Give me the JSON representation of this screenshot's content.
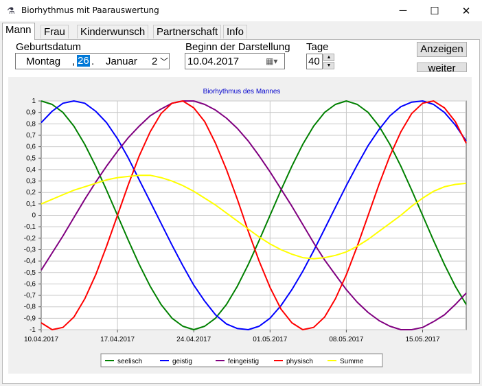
{
  "window": {
    "title": "Biorhythmus mit Paarauswertung",
    "minimize": "─",
    "maximize": "☐",
    "close": "✕",
    "icon": "flask-icon"
  },
  "tabs": [
    {
      "label": "Mann",
      "active": true
    },
    {
      "label": "Frau"
    },
    {
      "label": "Kinderwunsch"
    },
    {
      "label": "Partnerschaft"
    },
    {
      "label": "Info"
    }
  ],
  "form": {
    "birth_label": "Geburtsdatum",
    "birth_weekday": "Montag",
    "birth_sep": ",",
    "birth_day": "26",
    "birth_dot": ".",
    "birth_month": "Januar",
    "birth_year_partial": "2",
    "start_label": "Beginn der Darstellung",
    "start_date": "10.04.2017",
    "days_label": "Tage",
    "days_value": "40",
    "show_button": "Anzeigen",
    "next_button": "weiter"
  },
  "colors": {
    "seelisch": "#008000",
    "geistig": "#0000ff",
    "feingeistig": "#800080",
    "physisch": "#ff0000",
    "summe": "#ffff00",
    "title": "#0000cc"
  },
  "chart_data": {
    "type": "line",
    "title": "Biorhythmus des Mannes",
    "x_start": "10.04.2017",
    "x_end": "19.05.2017",
    "x_tick_labels": [
      "10.04.2017",
      "17.04.2017",
      "24.04.2017",
      "01.05.2017",
      "08.05.2017",
      "15.05.2017"
    ],
    "ylim": [
      -1,
      1
    ],
    "y_tick_labels": [
      "1",
      "0,9",
      "0,8",
      "0,7",
      "0,6",
      "0,5",
      "0,4",
      "0,3",
      "0,2",
      "0,1",
      "0",
      "-0,1",
      "-0,2",
      "-0,3",
      "-0,4",
      "-0,5",
      "-0,6",
      "-0,7",
      "-0,8",
      "-0,9",
      "-1"
    ],
    "grid": true,
    "legend_position": "bottom",
    "dates": [
      "10.04.2017",
      "11.04.2017",
      "12.04.2017",
      "13.04.2017",
      "14.04.2017",
      "15.04.2017",
      "16.04.2017",
      "17.04.2017",
      "18.04.2017",
      "19.04.2017",
      "20.04.2017",
      "21.04.2017",
      "22.04.2017",
      "23.04.2017",
      "24.04.2017",
      "25.04.2017",
      "26.04.2017",
      "27.04.2017",
      "28.04.2017",
      "29.04.2017",
      "30.04.2017",
      "01.05.2017",
      "02.05.2017",
      "03.05.2017",
      "04.05.2017",
      "05.05.2017",
      "06.05.2017",
      "07.05.2017",
      "08.05.2017",
      "09.05.2017",
      "10.05.2017",
      "11.05.2017",
      "12.05.2017",
      "13.05.2017",
      "14.05.2017",
      "15.05.2017",
      "16.05.2017",
      "17.05.2017",
      "18.05.2017",
      "19.05.2017"
    ],
    "series": [
      {
        "name": "seelisch",
        "values": [
          1.0,
          0.97,
          0.9,
          0.78,
          0.62,
          0.43,
          0.22,
          0.0,
          -0.22,
          -0.43,
          -0.62,
          -0.78,
          -0.9,
          -0.97,
          -1.0,
          -0.97,
          -0.9,
          -0.78,
          -0.62,
          -0.43,
          -0.22,
          0.0,
          0.22,
          0.43,
          0.62,
          0.78,
          0.9,
          0.97,
          1.0,
          0.97,
          0.9,
          0.78,
          0.62,
          0.43,
          0.22,
          0.0,
          -0.22,
          -0.43,
          -0.62,
          -0.78
        ]
      },
      {
        "name": "geistig",
        "values": [
          0.81,
          0.91,
          0.98,
          1.0,
          0.98,
          0.91,
          0.81,
          0.67,
          0.5,
          0.31,
          0.12,
          -0.07,
          -0.26,
          -0.44,
          -0.61,
          -0.75,
          -0.87,
          -0.95,
          -0.99,
          -1.0,
          -0.97,
          -0.9,
          -0.79,
          -0.65,
          -0.49,
          -0.31,
          -0.12,
          0.07,
          0.26,
          0.44,
          0.61,
          0.75,
          0.87,
          0.95,
          0.99,
          1.0,
          0.97,
          0.9,
          0.79,
          0.65
        ]
      },
      {
        "name": "feingeistig",
        "values": [
          -0.48,
          -0.33,
          -0.18,
          -0.02,
          0.14,
          0.29,
          0.43,
          0.56,
          0.68,
          0.78,
          0.87,
          0.93,
          0.98,
          1.0,
          1.0,
          0.97,
          0.92,
          0.85,
          0.76,
          0.65,
          0.52,
          0.38,
          0.23,
          0.08,
          -0.08,
          -0.24,
          -0.39,
          -0.52,
          -0.65,
          -0.76,
          -0.85,
          -0.92,
          -0.97,
          -1.0,
          -1.0,
          -0.98,
          -0.93,
          -0.87,
          -0.78,
          -0.68
        ]
      },
      {
        "name": "physisch",
        "values": [
          -0.94,
          -1.0,
          -0.98,
          -0.89,
          -0.73,
          -0.52,
          -0.27,
          0.0,
          0.27,
          0.52,
          0.73,
          0.89,
          0.98,
          1.0,
          0.94,
          0.82,
          0.63,
          0.4,
          0.14,
          -0.14,
          -0.4,
          -0.63,
          -0.82,
          -0.94,
          -1.0,
          -0.98,
          -0.89,
          -0.73,
          -0.52,
          -0.27,
          0.0,
          0.27,
          0.52,
          0.73,
          0.89,
          0.98,
          1.0,
          0.94,
          0.82,
          0.63
        ]
      },
      {
        "name": "Summe",
        "values": [
          0.1,
          0.14,
          0.18,
          0.22,
          0.25,
          0.28,
          0.31,
          0.33,
          0.34,
          0.35,
          0.35,
          0.33,
          0.3,
          0.26,
          0.21,
          0.15,
          0.09,
          0.02,
          -0.05,
          -0.12,
          -0.19,
          -0.25,
          -0.3,
          -0.34,
          -0.37,
          -0.38,
          -0.37,
          -0.35,
          -0.32,
          -0.27,
          -0.21,
          -0.14,
          -0.07,
          0.0,
          0.08,
          0.15,
          0.21,
          0.25,
          0.27,
          0.28
        ]
      }
    ]
  }
}
